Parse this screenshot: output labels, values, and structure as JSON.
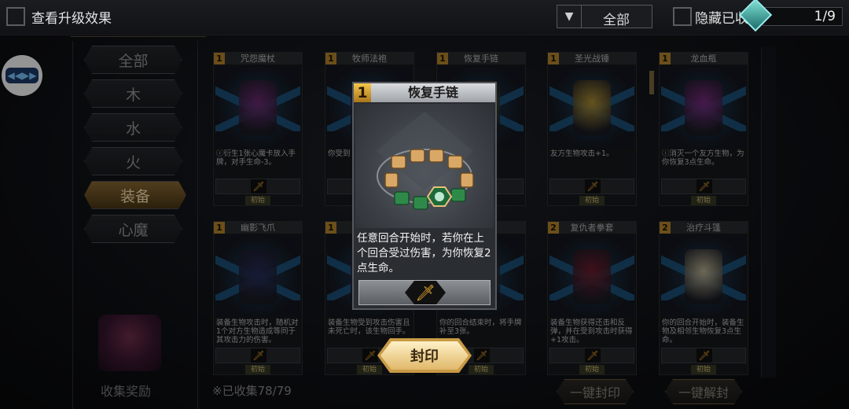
{
  "topbar": {
    "title": "查看升级效果",
    "filter_value": "全部",
    "hide_label": "隐藏已收",
    "page": "1/9"
  },
  "categories": [
    {
      "label": "全部",
      "active": false
    },
    {
      "label": "木",
      "active": false
    },
    {
      "label": "水",
      "active": false
    },
    {
      "label": "火",
      "active": false
    },
    {
      "label": "装备",
      "active": true
    },
    {
      "label": "心魔",
      "active": false
    }
  ],
  "chest_label": "收集奖励",
  "collected_text": "※已收集78/79",
  "cards": [
    {
      "level": "1",
      "name": "咒怨魔杖",
      "desc": "ⓘ衍生1张心魔卡放入手牌，对手生命-3。",
      "tag": "初始",
      "color": "#7a2a7a"
    },
    {
      "level": "1",
      "name": "牧师法袍",
      "desc": "你受到",
      "tag": "初始",
      "color": "#3a2a6a"
    },
    {
      "level": "1",
      "name": "恢复手链",
      "desc": "，若你伤害，",
      "tag": "初始",
      "color": "#5a5a2a"
    },
    {
      "level": "1",
      "name": "圣光战锤",
      "desc": "友方生物攻击+1。",
      "tag": "初始",
      "color": "#c8a030"
    },
    {
      "level": "1",
      "name": "龙血瓶",
      "desc": "ⓘ消灭一个友方生物，为你恢复3点生命。",
      "tag": "初始",
      "color": "#8a2a8a"
    },
    {
      "level": "1",
      "name": "幽影飞爪",
      "desc": "装备生物攻击时，随机对1个对方生物造成等同于其攻击力的伤害。",
      "tag": "初始",
      "color": "#2a2a5a"
    },
    {
      "level": "1",
      "name": "",
      "desc": "装备生物受到攻击伤害且未死亡时，该生物回手。",
      "tag": "初始",
      "color": "#4a2a6a"
    },
    {
      "level": "1",
      "name": "",
      "desc": "你的回合结束时，将手牌补至3张。",
      "tag": "初始",
      "color": "#3a3a3a"
    },
    {
      "level": "2",
      "name": "复仇者拳套",
      "desc": "装备生物获得还击和反弹，并在受到攻击时获得+1攻击。",
      "tag": "初始",
      "color": "#7a1a2a"
    },
    {
      "level": "2",
      "name": "治疗斗篷",
      "desc": "你的回合开始时，装备生物及相邻生物恢复3点生命。",
      "tag": "初始",
      "color": "#d8c8a0"
    }
  ],
  "bulk": {
    "seal_all": "一键封印",
    "unseal_all": "一键解封"
  },
  "popup": {
    "level": "1",
    "title": "恢复手链",
    "desc": "任意回合开始时，若你在上个回合受过伤害，为你恢复2点生命。",
    "seal_button": "封印"
  },
  "colors": {
    "accent_gold": "#e0b86a",
    "level_gold": "#b8892e",
    "dagger_orange": "#f3b12e"
  }
}
